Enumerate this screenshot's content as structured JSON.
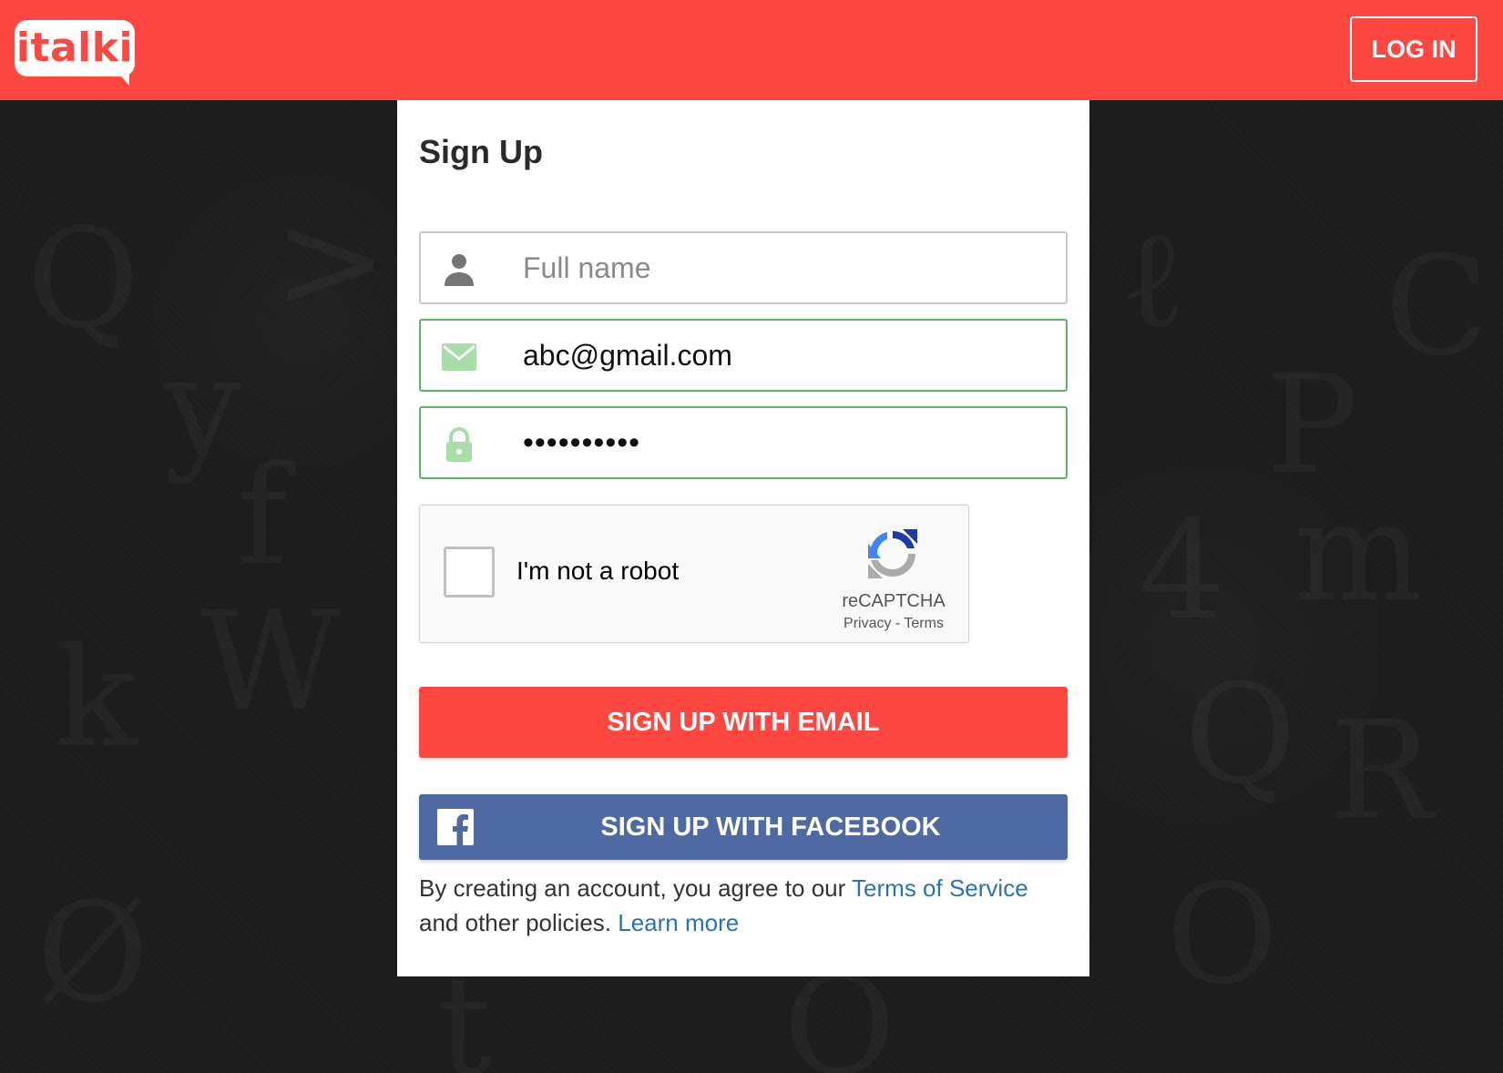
{
  "header": {
    "logo_text": "italki",
    "login_label": "LOG IN",
    "background_color": "#ff4742"
  },
  "signup": {
    "title": "Sign Up",
    "full_name": {
      "placeholder": "Full name",
      "value": "",
      "icon": "person-icon"
    },
    "email": {
      "value": "abc@gmail.com",
      "icon": "envelope-icon",
      "state": "valid"
    },
    "password": {
      "value": "••••••••••",
      "icon": "lock-icon",
      "state": "valid"
    },
    "recaptcha": {
      "label": "I'm not a robot",
      "brand": "reCAPTCHA",
      "privacy": "Privacy",
      "separator": " - ",
      "terms": "Terms",
      "checked": false
    },
    "email_button_label": "SIGN UP WITH EMAIL",
    "facebook_button_label": "SIGN UP WITH FACEBOOK",
    "facebook_icon": "facebook-icon",
    "terms_text": {
      "prefix": "By creating an account, you agree to our ",
      "tos_link": "Terms of Service",
      "middle": " and other policies. ",
      "learn_more_link": "Learn more"
    }
  },
  "colors": {
    "brand_red": "#ff4742",
    "facebook_blue": "#4f6aa3",
    "valid_green": "#5cb85c",
    "link_blue": "#2a72b5"
  }
}
